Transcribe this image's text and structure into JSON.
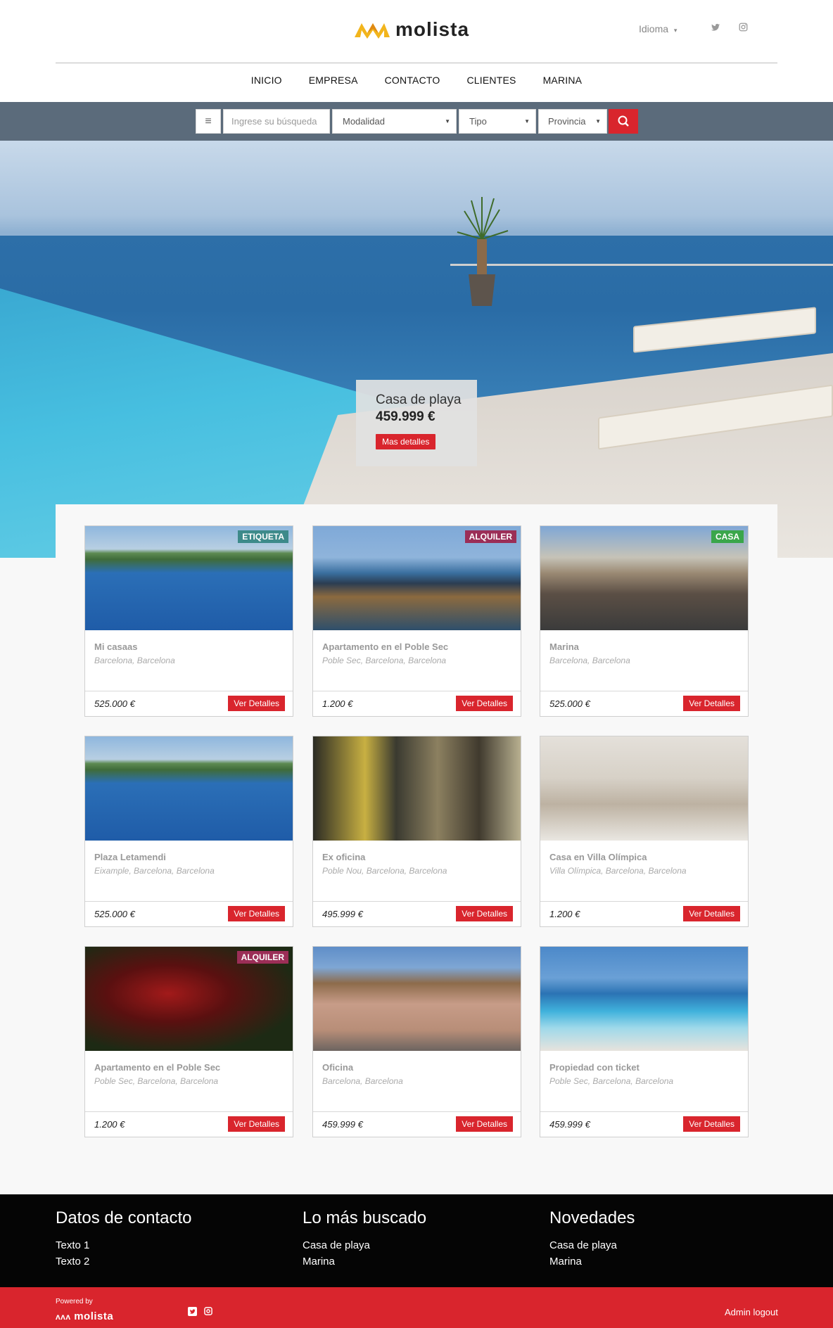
{
  "brand": {
    "name": "molista",
    "accent": "#d9252d",
    "logo_gold": "#f2b51d"
  },
  "header": {
    "language_label": "Idioma",
    "social": [
      {
        "icon": "twitter-icon"
      },
      {
        "icon": "instagram-icon"
      }
    ],
    "nav": [
      "INICIO",
      "EMPRESA",
      "CONTACTO",
      "CLIENTES",
      "MARINA"
    ]
  },
  "search": {
    "placeholder": "Ingrese su búsqueda",
    "modalidad": "Modalidad",
    "tipo": "Tipo",
    "provincia": "Provincia"
  },
  "hero": {
    "title": "Casa de playa",
    "price": "459.999 €",
    "button": "Mas detalles"
  },
  "listings": [
    {
      "title": "Mi casaas",
      "location": "Barcelona, Barcelona",
      "price": "525.000 €",
      "button": "Ver Detalles",
      "tag": "ETIQUETA",
      "tag_color": "#3d8a8a"
    },
    {
      "title": "Apartamento en el Poble Sec",
      "location": "Poble Sec, Barcelona, Barcelona",
      "price": "1.200 €",
      "button": "Ver Detalles",
      "tag": "ALQUILER",
      "tag_color": "#9b2e57"
    },
    {
      "title": "Marina",
      "location": "Barcelona, Barcelona",
      "price": "525.000 €",
      "button": "Ver Detalles",
      "tag": "CASA",
      "tag_color": "#3aa64b"
    },
    {
      "title": "Plaza Letamendi",
      "location": "Eixample, Barcelona, Barcelona",
      "price": "525.000 €",
      "button": "Ver Detalles",
      "tag": "",
      "tag_color": ""
    },
    {
      "title": "Ex oficina",
      "location": "Poble Nou, Barcelona, Barcelona",
      "price": "495.999 €",
      "button": "Ver Detalles",
      "tag": "",
      "tag_color": ""
    },
    {
      "title": "Casa en Villa Olímpica",
      "location": "Villa Olímpica, Barcelona, Barcelona",
      "price": "1.200 €",
      "button": "Ver Detalles",
      "tag": "",
      "tag_color": ""
    },
    {
      "title": "Apartamento en el Poble Sec",
      "location": "Poble Sec, Barcelona, Barcelona",
      "price": "1.200 €",
      "button": "Ver Detalles",
      "tag": "ALQUILER",
      "tag_color": "#9b2e57"
    },
    {
      "title": "Oficina",
      "location": "Barcelona, Barcelona",
      "price": "459.999 €",
      "button": "Ver Detalles",
      "tag": "",
      "tag_color": ""
    },
    {
      "title": "Propiedad con ticket",
      "location": "Poble Sec, Barcelona, Barcelona",
      "price": "459.999 €",
      "button": "Ver Detalles",
      "tag": "",
      "tag_color": ""
    }
  ],
  "footer": {
    "contact": {
      "heading": "Datos de contacto",
      "items": [
        "Texto 1",
        "Texto 2"
      ]
    },
    "popular": {
      "heading": "Lo más buscado",
      "items": [
        "Casa de playa",
        "Marina"
      ]
    },
    "news": {
      "heading": "Novedades",
      "items": [
        "Casa de playa",
        "Marina"
      ]
    },
    "powered_by": "Powered by",
    "powered_logo": "molista",
    "admin_link": "Admin logout"
  }
}
